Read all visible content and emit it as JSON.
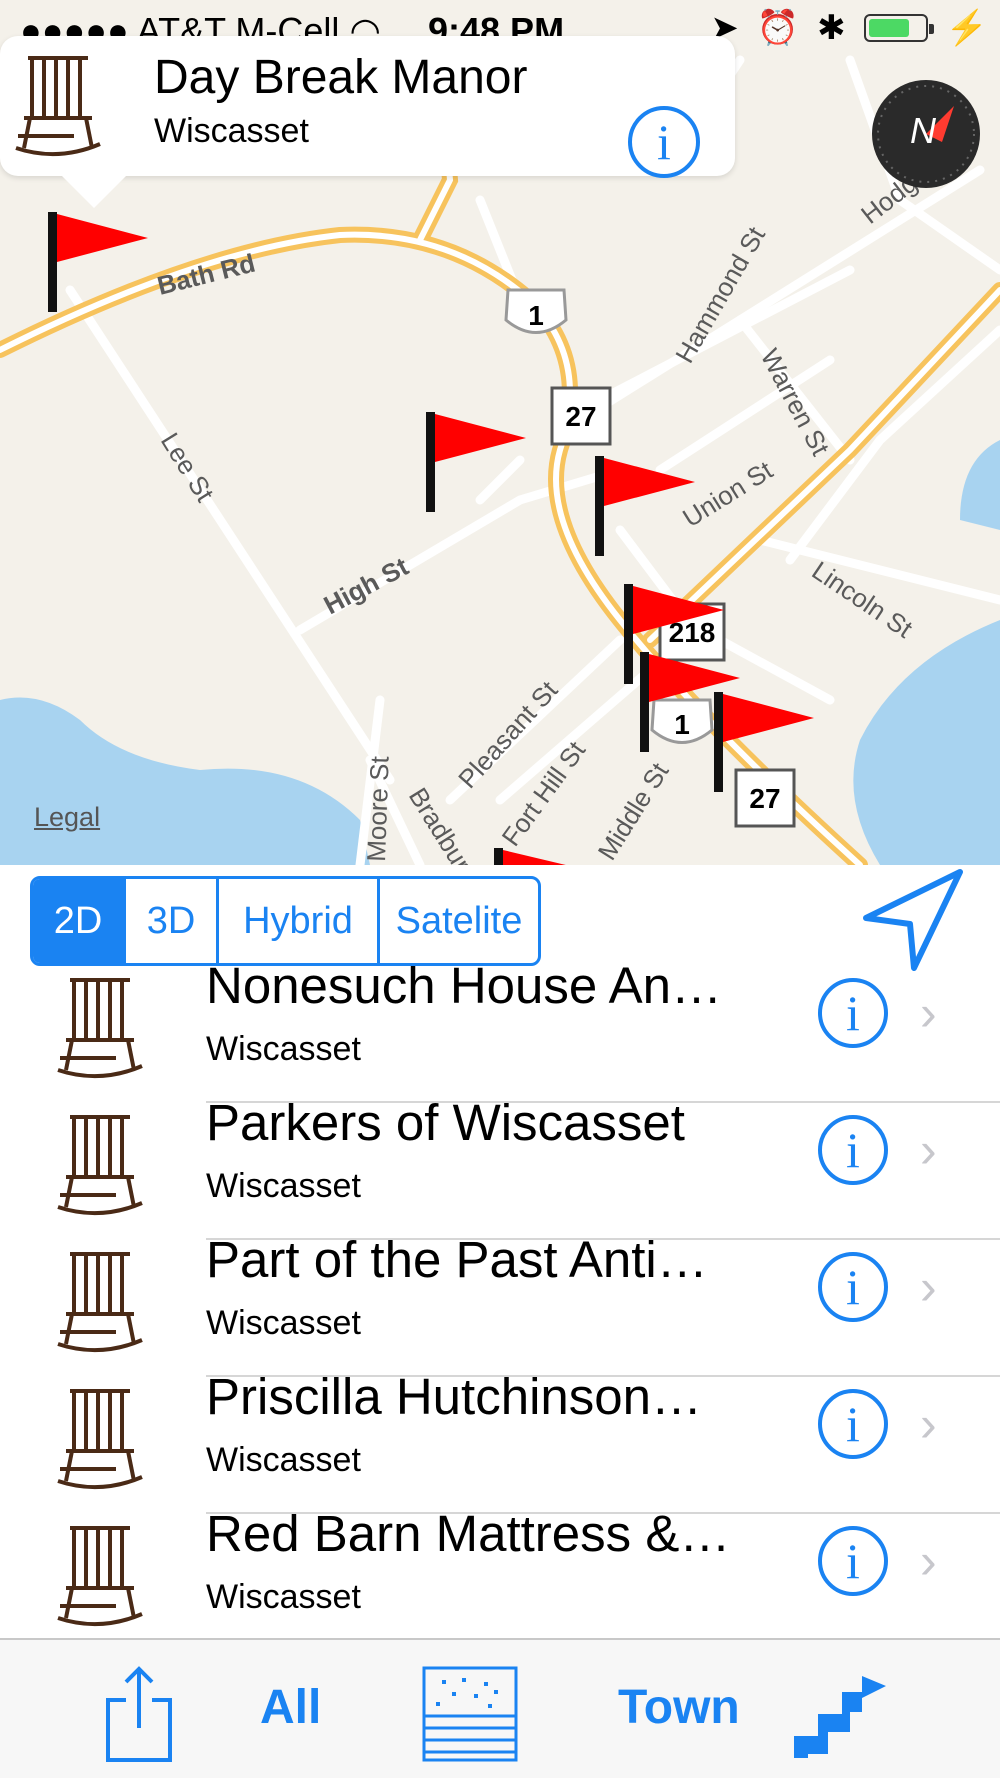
{
  "status_bar": {
    "signal": "●●●●●",
    "carrier": "AT&T M-Cell",
    "time": "9:48 PM",
    "battery_level": 0.75
  },
  "callout": {
    "title": "Day Break Manor",
    "subtitle": "Wiscasset",
    "info": "i"
  },
  "map": {
    "streets": [
      "Bath Rd",
      "Lee St",
      "High St",
      "Hammond St",
      "Warren St",
      "Union St",
      "Lincoln St",
      "Pleasant St",
      "Fort Hill St",
      "Middle St",
      "Bradbury St",
      "Moore St",
      "Hodge St"
    ],
    "route_shields": [
      "1",
      "27",
      "218",
      "1",
      "27"
    ],
    "legal": "Legal",
    "compass_label": "N",
    "colors": {
      "land": "#f4f1ea",
      "water": "#a8d3f0",
      "highway": "#f7c35d",
      "flag": "#ff0000"
    }
  },
  "map_type": {
    "options": [
      "2D",
      "3D",
      "Hybrid",
      "Satelite"
    ],
    "selected": "2D"
  },
  "list": [
    {
      "name": "Nonesuch House An…",
      "location": "Wiscasset"
    },
    {
      "name": "Parkers of Wiscasset",
      "location": "Wiscasset"
    },
    {
      "name": "Part of the Past Anti…",
      "location": "Wiscasset"
    },
    {
      "name": "Priscilla Hutchinson…",
      "location": "Wiscasset"
    },
    {
      "name": "Red Barn Mattress &…",
      "location": "Wiscasset"
    }
  ],
  "toolbar": {
    "all_label": "All",
    "town_label": "Town",
    "icons": [
      "share-icon",
      "list-view-icon",
      "directions-icon"
    ]
  },
  "colors": {
    "accent": "#1a83f2"
  }
}
